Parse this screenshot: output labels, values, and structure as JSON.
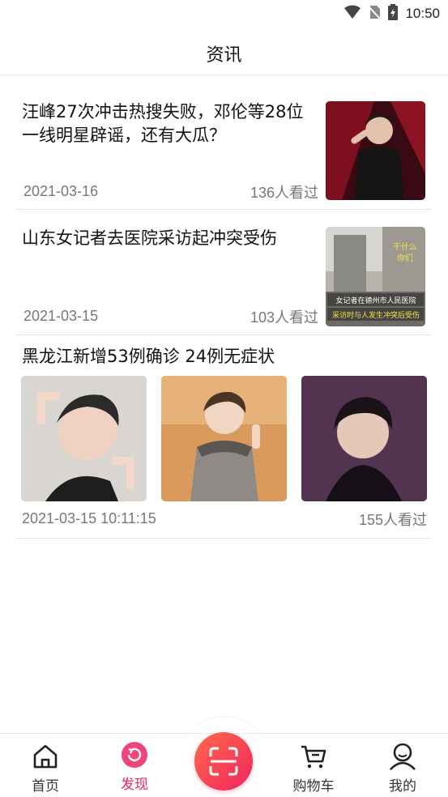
{
  "status": {
    "time": "10:50"
  },
  "header": {
    "title": "资讯"
  },
  "news": [
    {
      "title": "汪峰27次冲击热搜失败，邓伦等28位一线明星辟谣，还有大瓜？",
      "date": "2021-03-16",
      "views": "136人看过"
    },
    {
      "title": "山东女记者去医院采访起冲突受伤",
      "date": "2021-03-15",
      "views": "103人看过",
      "image_caption": [
        "干什么",
        "你们",
        "女记者在德州市人民医院",
        "采访时与人发生冲突后受伤"
      ]
    },
    {
      "title": "黑龙江新增53例确诊 24例无症状",
      "date": "2021-03-15 10:11:15",
      "views": "155人看过"
    }
  ],
  "tabbar": {
    "items": [
      {
        "label": "首页",
        "icon": "home-icon"
      },
      {
        "label": "发现",
        "icon": "discover-icon",
        "active": true
      },
      {
        "label": "购物车",
        "icon": "cart-icon"
      },
      {
        "label": "我的",
        "icon": "user-icon"
      }
    ],
    "center": {
      "icon": "scan-icon"
    }
  },
  "colors": {
    "accent": "#f0245f",
    "text": "#111111",
    "muted": "#777777"
  }
}
